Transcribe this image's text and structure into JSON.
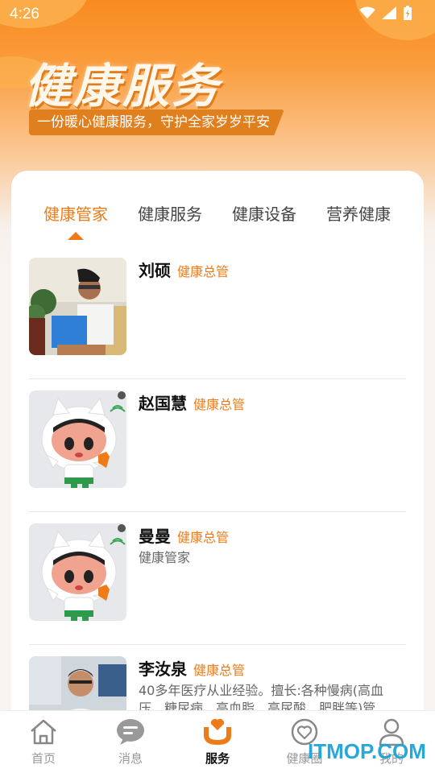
{
  "status": {
    "time": "4:26"
  },
  "hero": {
    "title": "健康服务",
    "subtitle": "一份暖心健康服务，守护全家岁岁平安"
  },
  "tabs": [
    {
      "label": "健康管家",
      "active": true
    },
    {
      "label": "健康服务",
      "active": false
    },
    {
      "label": "健康设备",
      "active": false
    },
    {
      "label": "营养健康",
      "active": false
    }
  ],
  "staff": [
    {
      "name": "刘硕",
      "role": "健康总管",
      "desc": "",
      "avatar": "photo-doctor"
    },
    {
      "name": "赵国慧",
      "role": "健康总管",
      "desc": "",
      "avatar": "mascot"
    },
    {
      "name": "曼曼",
      "role": "健康总管",
      "desc": "健康管家",
      "avatar": "mascot"
    },
    {
      "name": "李汝泉",
      "role": "健康总管",
      "desc": "40多年医疗从业经验。擅长:各种慢病(高血压、糖尿病、高血脂、高尿酸、肥胖等)管",
      "avatar": "photo-doctor2"
    }
  ],
  "nav": [
    {
      "label": "首页",
      "icon": "home-icon",
      "active": false
    },
    {
      "label": "消息",
      "icon": "message-icon",
      "active": false
    },
    {
      "label": "服务",
      "icon": "service-icon",
      "active": true
    },
    {
      "label": "健康圈",
      "icon": "heart-circle-icon",
      "active": false
    },
    {
      "label": "我的",
      "icon": "user-icon",
      "active": false
    }
  ],
  "watermark": "ITMOP.COM",
  "colors": {
    "accent": "#ee7b17",
    "hero_top": "#f98b1f"
  }
}
